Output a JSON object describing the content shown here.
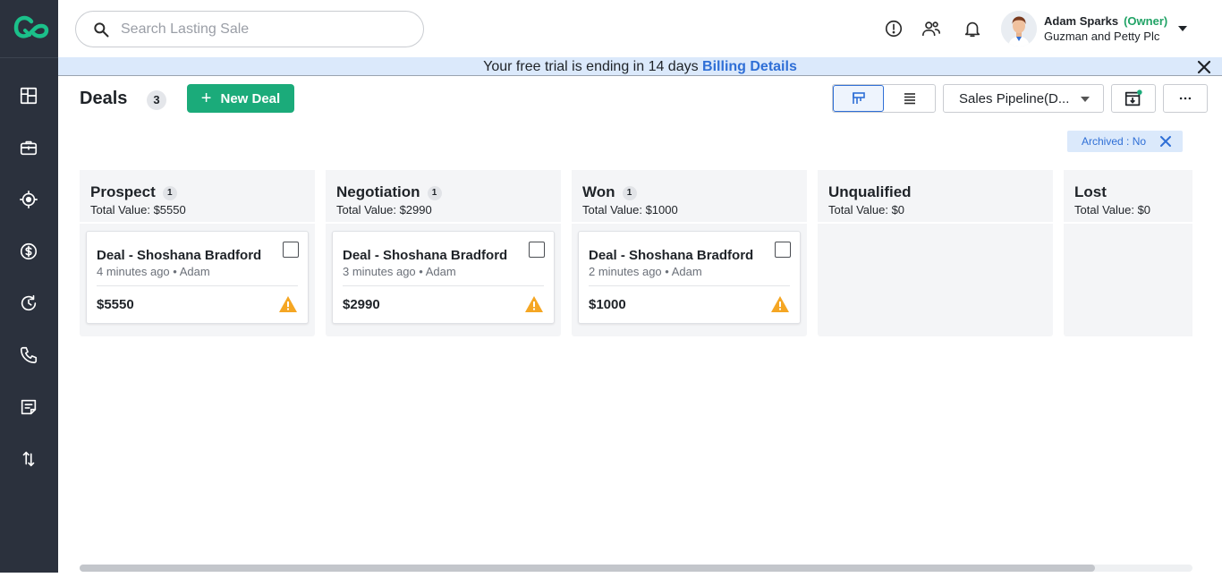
{
  "search": {
    "placeholder": "Search Lasting Sale"
  },
  "sidebar": {
    "items": [
      {
        "name": "dashboard",
        "icon": "dashboard-icon"
      },
      {
        "name": "deals",
        "icon": "briefcase-icon"
      },
      {
        "name": "leads",
        "icon": "target-icon"
      },
      {
        "name": "sales",
        "icon": "dollar-icon"
      },
      {
        "name": "activities",
        "icon": "history-icon"
      },
      {
        "name": "calls",
        "icon": "phone-icon"
      },
      {
        "name": "notes",
        "icon": "notes-icon"
      },
      {
        "name": "import-export",
        "icon": "transfer-icon"
      }
    ]
  },
  "header": {
    "icons": [
      "info-icon",
      "contacts-icon",
      "bell-icon"
    ],
    "user": {
      "name": "Adam Sparks",
      "role": "(Owner)",
      "company": "Guzman and Petty Plc"
    }
  },
  "banner": {
    "text": "Your free trial is ending in 14 days ",
    "link": "Billing Details"
  },
  "page": {
    "title": "Deals",
    "count": "3",
    "new_deal_label": "New Deal"
  },
  "toolbar": {
    "pipeline": "Sales Pipeline(D..."
  },
  "filter": {
    "chip": "Archived : No"
  },
  "columns": [
    {
      "title": "Prospect",
      "count": "1",
      "total": "Total Value: $5550",
      "cards": [
        {
          "title": "Deal - Shoshana Bradford",
          "meta": "4 minutes ago • Adam",
          "value": "$5550"
        }
      ]
    },
    {
      "title": "Negotiation",
      "count": "1",
      "total": "Total Value: $2990",
      "cards": [
        {
          "title": "Deal - Shoshana Bradford",
          "meta": "3 minutes ago • Adam",
          "value": "$2990"
        }
      ]
    },
    {
      "title": "Won",
      "count": "1",
      "total": "Total Value: $1000",
      "cards": [
        {
          "title": "Deal - Shoshana Bradford",
          "meta": "2 minutes ago • Adam",
          "value": "$1000"
        }
      ]
    },
    {
      "title": "Unqualified",
      "count": "",
      "total": "Total Value: $0",
      "cards": []
    },
    {
      "title": "Lost",
      "count": "",
      "total": "Total Value: $0",
      "cards": []
    }
  ],
  "colors": {
    "accent": "#1bab7a",
    "brand": "#2f6fd6",
    "sidebar": "#2b313d",
    "warning": "#f5a623",
    "owner": "#21a366"
  }
}
